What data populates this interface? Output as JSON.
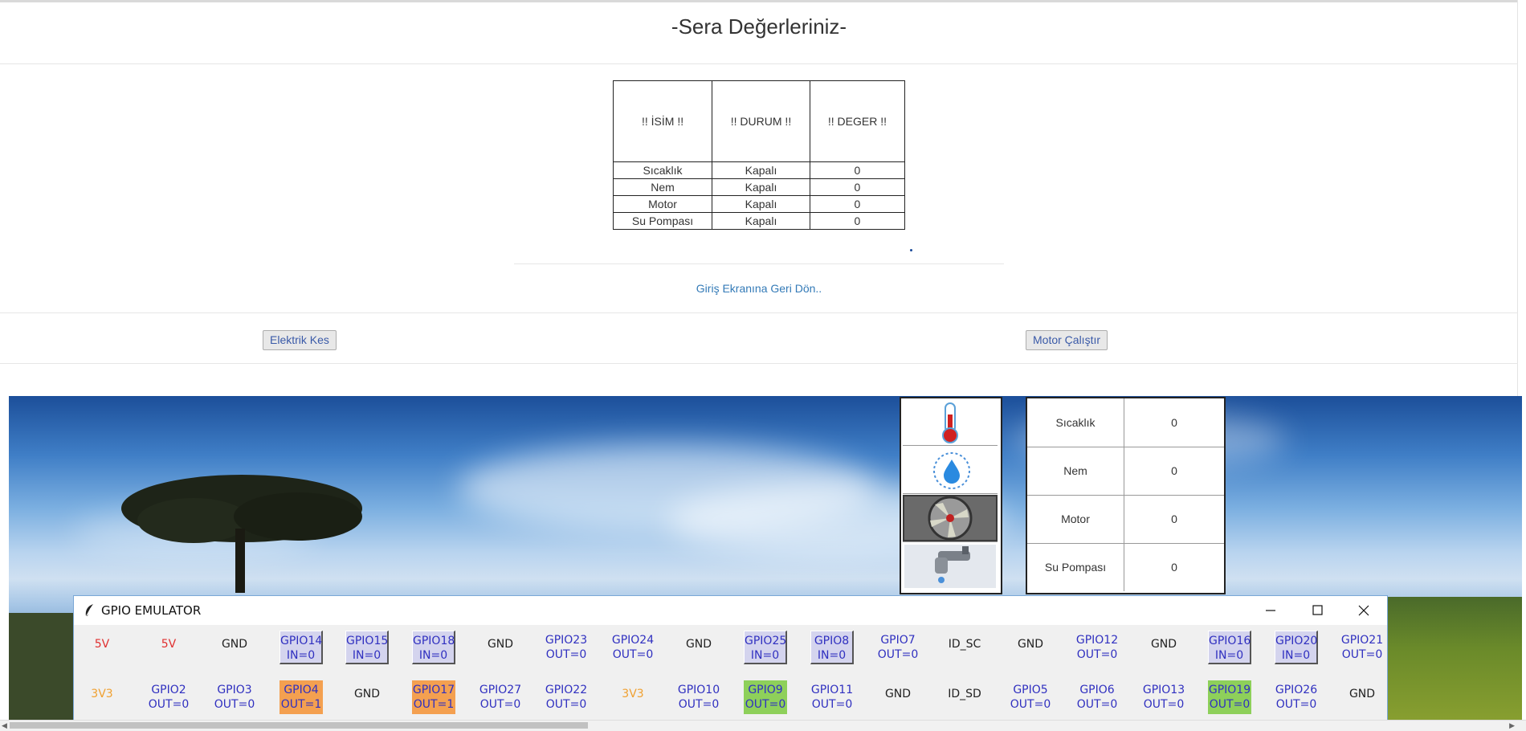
{
  "page": {
    "title": "-Sera Değerleriniz-",
    "back_link": "Giriş Ekranına Geri Dön..",
    "buttons": {
      "power_off": "Elektrik Kes",
      "motor_run": "Motor Çalıştır"
    }
  },
  "values_table": {
    "headers": [
      "!! İSİM !!",
      "!! DURUM !!",
      "!! DEGER !!"
    ],
    "rows": [
      {
        "name": "Sıcaklık",
        "status": "Kapalı",
        "value": "0"
      },
      {
        "name": "Nem",
        "status": "Kapalı",
        "value": "0"
      },
      {
        "name": "Motor",
        "status": "Kapalı",
        "value": "0"
      },
      {
        "name": "Su Pompası",
        "status": "Kapalı",
        "value": "0"
      }
    ]
  },
  "sensor_panel": {
    "icons": [
      "thermometer-icon",
      "water-drop-icon",
      "fan-icon",
      "faucet-icon"
    ],
    "rows": [
      {
        "name": "Sıcaklık",
        "value": "0"
      },
      {
        "name": "Nem",
        "value": "0"
      },
      {
        "name": "Motor",
        "value": "0"
      },
      {
        "name": "Su Pompası",
        "value": "0"
      }
    ]
  },
  "gpio_window": {
    "title": "GPIO EMULATOR",
    "controls": [
      "minimize",
      "maximize",
      "close"
    ],
    "row1": [
      {
        "label": "5V",
        "type": "power5"
      },
      {
        "label": "5V",
        "type": "power5"
      },
      {
        "label": "GND",
        "type": "gnd"
      },
      {
        "label": "GPIO14\nIN=0",
        "type": "in"
      },
      {
        "label": "GPIO15\nIN=0",
        "type": "in"
      },
      {
        "label": "GPIO18\nIN=0",
        "type": "in"
      },
      {
        "label": "GND",
        "type": "gnd"
      },
      {
        "label": "GPIO23\nOUT=0",
        "type": "out"
      },
      {
        "label": "GPIO24\nOUT=0",
        "type": "out"
      },
      {
        "label": "GND",
        "type": "gnd"
      },
      {
        "label": "GPIO25\nIN=0",
        "type": "in"
      },
      {
        "label": "GPIO8\nIN=0",
        "type": "in"
      },
      {
        "label": "GPIO7\nOUT=0",
        "type": "out"
      },
      {
        "label": "ID_SC",
        "type": "gnd"
      },
      {
        "label": "GND",
        "type": "gnd"
      },
      {
        "label": "GPIO12\nOUT=0",
        "type": "out"
      },
      {
        "label": "GND",
        "type": "gnd"
      },
      {
        "label": "GPIO16\nIN=0",
        "type": "in"
      },
      {
        "label": "GPIO20\nIN=0",
        "type": "in"
      },
      {
        "label": "GPIO21\nOUT=0",
        "type": "out"
      }
    ],
    "row2": [
      {
        "label": "3V3",
        "type": "power3"
      },
      {
        "label": "GPIO2\nOUT=0",
        "type": "out"
      },
      {
        "label": "GPIO3\nOUT=0",
        "type": "out"
      },
      {
        "label": "GPIO4\nOUT=1",
        "type": "high"
      },
      {
        "label": "GND",
        "type": "gnd"
      },
      {
        "label": "GPIO17\nOUT=1",
        "type": "high"
      },
      {
        "label": "GPIO27\nOUT=0",
        "type": "out"
      },
      {
        "label": "GPIO22\nOUT=0",
        "type": "out"
      },
      {
        "label": "3V3",
        "type": "power3"
      },
      {
        "label": "GPIO10\nOUT=0",
        "type": "out"
      },
      {
        "label": "GPIO9\nOUT=0",
        "type": "green"
      },
      {
        "label": "GPIO11\nOUT=0",
        "type": "out"
      },
      {
        "label": "GND",
        "type": "gnd"
      },
      {
        "label": "ID_SD",
        "type": "gnd"
      },
      {
        "label": "GPIO5\nOUT=0",
        "type": "out"
      },
      {
        "label": "GPIO6\nOUT=0",
        "type": "out"
      },
      {
        "label": "GPIO13\nOUT=0",
        "type": "out"
      },
      {
        "label": "GPIO19\nOUT=0",
        "type": "green"
      },
      {
        "label": "GPIO26\nOUT=0",
        "type": "out"
      },
      {
        "label": "GND",
        "type": "gnd"
      }
    ],
    "colors": {
      "power5": "#e03030",
      "power3": "#f0a030",
      "gnd": "#222222",
      "gpio_text": "#3030c0",
      "high_bg": "#f4a050",
      "green_bg": "#8ed05a",
      "in_bg": "#d4d4ee"
    }
  }
}
